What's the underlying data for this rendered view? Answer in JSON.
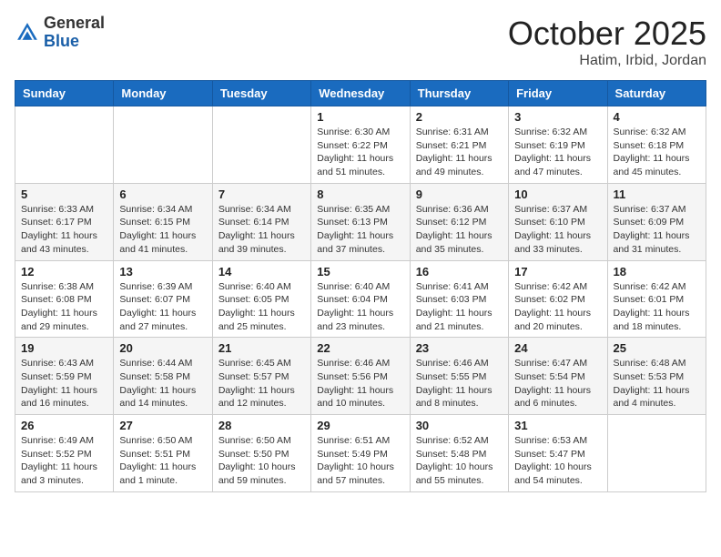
{
  "header": {
    "logo_general": "General",
    "logo_blue": "Blue",
    "month": "October 2025",
    "location": "Hatim, Irbid, Jordan"
  },
  "weekdays": [
    "Sunday",
    "Monday",
    "Tuesday",
    "Wednesday",
    "Thursday",
    "Friday",
    "Saturday"
  ],
  "weeks": [
    [
      {
        "day": "",
        "info": ""
      },
      {
        "day": "",
        "info": ""
      },
      {
        "day": "",
        "info": ""
      },
      {
        "day": "1",
        "info": "Sunrise: 6:30 AM\nSunset: 6:22 PM\nDaylight: 11 hours\nand 51 minutes."
      },
      {
        "day": "2",
        "info": "Sunrise: 6:31 AM\nSunset: 6:21 PM\nDaylight: 11 hours\nand 49 minutes."
      },
      {
        "day": "3",
        "info": "Sunrise: 6:32 AM\nSunset: 6:19 PM\nDaylight: 11 hours\nand 47 minutes."
      },
      {
        "day": "4",
        "info": "Sunrise: 6:32 AM\nSunset: 6:18 PM\nDaylight: 11 hours\nand 45 minutes."
      }
    ],
    [
      {
        "day": "5",
        "info": "Sunrise: 6:33 AM\nSunset: 6:17 PM\nDaylight: 11 hours\nand 43 minutes."
      },
      {
        "day": "6",
        "info": "Sunrise: 6:34 AM\nSunset: 6:15 PM\nDaylight: 11 hours\nand 41 minutes."
      },
      {
        "day": "7",
        "info": "Sunrise: 6:34 AM\nSunset: 6:14 PM\nDaylight: 11 hours\nand 39 minutes."
      },
      {
        "day": "8",
        "info": "Sunrise: 6:35 AM\nSunset: 6:13 PM\nDaylight: 11 hours\nand 37 minutes."
      },
      {
        "day": "9",
        "info": "Sunrise: 6:36 AM\nSunset: 6:12 PM\nDaylight: 11 hours\nand 35 minutes."
      },
      {
        "day": "10",
        "info": "Sunrise: 6:37 AM\nSunset: 6:10 PM\nDaylight: 11 hours\nand 33 minutes."
      },
      {
        "day": "11",
        "info": "Sunrise: 6:37 AM\nSunset: 6:09 PM\nDaylight: 11 hours\nand 31 minutes."
      }
    ],
    [
      {
        "day": "12",
        "info": "Sunrise: 6:38 AM\nSunset: 6:08 PM\nDaylight: 11 hours\nand 29 minutes."
      },
      {
        "day": "13",
        "info": "Sunrise: 6:39 AM\nSunset: 6:07 PM\nDaylight: 11 hours\nand 27 minutes."
      },
      {
        "day": "14",
        "info": "Sunrise: 6:40 AM\nSunset: 6:05 PM\nDaylight: 11 hours\nand 25 minutes."
      },
      {
        "day": "15",
        "info": "Sunrise: 6:40 AM\nSunset: 6:04 PM\nDaylight: 11 hours\nand 23 minutes."
      },
      {
        "day": "16",
        "info": "Sunrise: 6:41 AM\nSunset: 6:03 PM\nDaylight: 11 hours\nand 21 minutes."
      },
      {
        "day": "17",
        "info": "Sunrise: 6:42 AM\nSunset: 6:02 PM\nDaylight: 11 hours\nand 20 minutes."
      },
      {
        "day": "18",
        "info": "Sunrise: 6:42 AM\nSunset: 6:01 PM\nDaylight: 11 hours\nand 18 minutes."
      }
    ],
    [
      {
        "day": "19",
        "info": "Sunrise: 6:43 AM\nSunset: 5:59 PM\nDaylight: 11 hours\nand 16 minutes."
      },
      {
        "day": "20",
        "info": "Sunrise: 6:44 AM\nSunset: 5:58 PM\nDaylight: 11 hours\nand 14 minutes."
      },
      {
        "day": "21",
        "info": "Sunrise: 6:45 AM\nSunset: 5:57 PM\nDaylight: 11 hours\nand 12 minutes."
      },
      {
        "day": "22",
        "info": "Sunrise: 6:46 AM\nSunset: 5:56 PM\nDaylight: 11 hours\nand 10 minutes."
      },
      {
        "day": "23",
        "info": "Sunrise: 6:46 AM\nSunset: 5:55 PM\nDaylight: 11 hours\nand 8 minutes."
      },
      {
        "day": "24",
        "info": "Sunrise: 6:47 AM\nSunset: 5:54 PM\nDaylight: 11 hours\nand 6 minutes."
      },
      {
        "day": "25",
        "info": "Sunrise: 6:48 AM\nSunset: 5:53 PM\nDaylight: 11 hours\nand 4 minutes."
      }
    ],
    [
      {
        "day": "26",
        "info": "Sunrise: 6:49 AM\nSunset: 5:52 PM\nDaylight: 11 hours\nand 3 minutes."
      },
      {
        "day": "27",
        "info": "Sunrise: 6:50 AM\nSunset: 5:51 PM\nDaylight: 11 hours\nand 1 minute."
      },
      {
        "day": "28",
        "info": "Sunrise: 6:50 AM\nSunset: 5:50 PM\nDaylight: 10 hours\nand 59 minutes."
      },
      {
        "day": "29",
        "info": "Sunrise: 6:51 AM\nSunset: 5:49 PM\nDaylight: 10 hours\nand 57 minutes."
      },
      {
        "day": "30",
        "info": "Sunrise: 6:52 AM\nSunset: 5:48 PM\nDaylight: 10 hours\nand 55 minutes."
      },
      {
        "day": "31",
        "info": "Sunrise: 6:53 AM\nSunset: 5:47 PM\nDaylight: 10 hours\nand 54 minutes."
      },
      {
        "day": "",
        "info": ""
      }
    ]
  ]
}
